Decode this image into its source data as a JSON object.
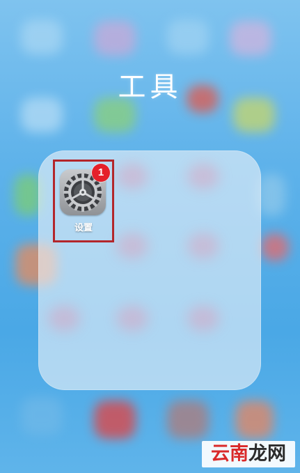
{
  "folder": {
    "title": "工具",
    "apps": [
      {
        "label": "设置",
        "icon": "gear-icon",
        "badge": "1",
        "highlighted": true
      }
    ]
  },
  "watermark": {
    "part_red": "云南",
    "part_dark": "龙网"
  },
  "colors": {
    "wallpaper": "#5eb2ea",
    "highlight_border": "#b3262b",
    "badge": "#e5202a"
  }
}
